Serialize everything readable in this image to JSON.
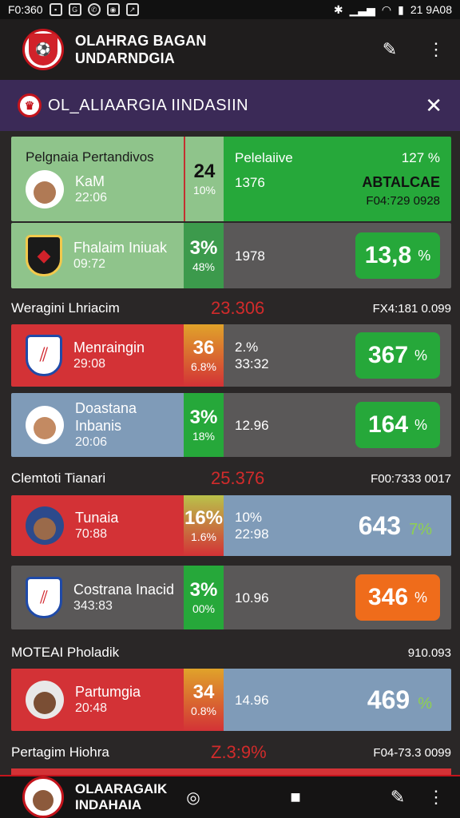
{
  "status_bar": {
    "time": "F0:360",
    "right_text": "21 9A08"
  },
  "app": {
    "title_line1": "OLAHRAG BAGAN",
    "title_line2": "UNDARNDGIA"
  },
  "banner": {
    "title": "OL_ALIAARGIA IINDASIIN"
  },
  "rows": {
    "r1": {
      "header": "Pelgnaia Pertandivos",
      "name": "KaM",
      "time": "22:06",
      "score": "24",
      "score_pct": "10%",
      "right_label": "Pelelaiive",
      "right_pct": "127 %",
      "mid": "1376",
      "right_title": "ABTALCAE",
      "right_code": "F04:729 0928"
    },
    "r2": {
      "name": "Fhalaim Iniuak",
      "time": "09:72",
      "score": "3%",
      "score_pct": "48%",
      "mid": "1978",
      "pill_num": "13,8",
      "pill_pct": "%"
    },
    "s1": {
      "left": "Weragini Lhriacim",
      "center": "23.306",
      "right": "FX4:181 0.099"
    },
    "r3": {
      "name": "Menraingin",
      "time": "29:08",
      "score": "36",
      "score_pct": "6.8%",
      "mid1": "2.%",
      "mid2": "33:32",
      "pill_num": "367",
      "pill_pct": "%"
    },
    "r4": {
      "name": "Doastana Inbanis",
      "time": "20:06",
      "score": "3%",
      "score_pct": "18%",
      "mid": "12.96",
      "pill_num": "164",
      "pill_pct": "%"
    },
    "s2": {
      "left": "Clemtoti Tianari",
      "center": "25.376",
      "right": "F00:7333 0017"
    },
    "r5": {
      "name": "Tunaia",
      "time": "70:88",
      "score": "16%",
      "score_pct": "1.6%",
      "mid1": "10%",
      "mid2": "22:98",
      "big_num": "643",
      "big_pct": "7%"
    },
    "r6": {
      "name": "Costrana Inacid",
      "time": "343:83",
      "score": "3%",
      "score_pct": "00%",
      "mid": "10.96",
      "pill_num": "346",
      "pill_pct": "%"
    },
    "s3": {
      "left": "MOTEAI Pholadik",
      "right": "910.093"
    },
    "r7": {
      "name": "Partumgia",
      "time": "20:48",
      "score": "34",
      "score_pct": "0.8%",
      "mid": "14.96",
      "big_num": "469",
      "big_pct": "%"
    },
    "s4": {
      "left": "Pertagim Hiohra",
      "center": "Z.3:9%",
      "right": "F04-73.3 0099"
    }
  },
  "bottom": {
    "title_line1": "OLAARAGAIK",
    "title_line2": "INDAHAIA"
  },
  "colors": {
    "green_light": "#8fc48b",
    "green_bright": "#26a83a",
    "red": "#d33236",
    "blue_grey": "#7f9bb8",
    "grey": "#5a5858",
    "orange": "#ef6c1b",
    "purple": "#3b2a57"
  }
}
